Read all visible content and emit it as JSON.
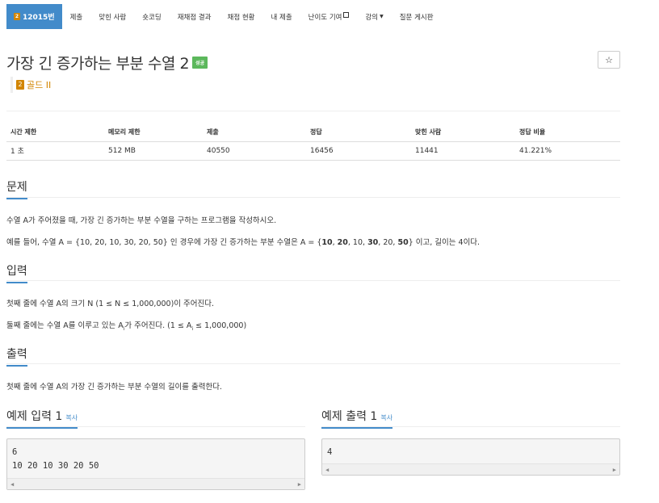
{
  "tabs": [
    {
      "label": "12015번",
      "tier": "2",
      "active": true
    },
    {
      "label": "제출"
    },
    {
      "label": "맞힌 사람"
    },
    {
      "label": "숏코딩"
    },
    {
      "label": "재채점 결과"
    },
    {
      "label": "채점 현황"
    },
    {
      "label": "내 제출"
    },
    {
      "label": "난이도 기여"
    },
    {
      "label": "강의"
    },
    {
      "label": "질문 게시판"
    }
  ],
  "problem": {
    "title": "가장 긴 증가하는 부분 수열 2",
    "badge": "성공",
    "star": "☆",
    "tier_icon": "2",
    "tier_label": "골드 II"
  },
  "info": {
    "headers": [
      "시간 제한",
      "메모리 제한",
      "제출",
      "정답",
      "맞힌 사람",
      "정답 비율"
    ],
    "values": [
      "1 초",
      "512 MB",
      "40550",
      "16456",
      "11441",
      "41.221%"
    ]
  },
  "sections": {
    "problem_head": "문제",
    "problem_p1": "수열 A가 주어졌을 때, 가장 긴 증가하는 부분 수열을 구하는 프로그램을 작성하시오.",
    "problem_p2_a": "예를 들어, 수열 A = {10, 20, 10, 30, 20, 50} 인 경우에 가장 긴 증가하는 부분 수열은 A = {",
    "problem_p2_b1": "10",
    "problem_p2_c1": ", ",
    "problem_p2_b2": "20",
    "problem_p2_c2": ", 10, ",
    "problem_p2_b3": "30",
    "problem_p2_c3": ", 20, ",
    "problem_p2_b4": "50",
    "problem_p2_d": "} 이고, 길이는 4이다.",
    "input_head": "입력",
    "input_p1": "첫째 줄에 수열 A의 크기 N (1 ≤ N ≤ 1,000,000)이 주어진다.",
    "input_p2_a": "둘째 줄에는 수열 A를 이루고 있는 A",
    "input_p2_sub1": "i",
    "input_p2_b": "가 주어진다. (1 ≤ A",
    "input_p2_sub2": "i",
    "input_p2_c": " ≤ 1,000,000)",
    "output_head": "출력",
    "output_p1": "첫째 줄에 수열 A의 가장 긴 증가하는 부분 수열의 길이를 출력한다."
  },
  "samples": {
    "input_title": "예제 입력 1",
    "output_title": "예제 출력 1",
    "copy_label": "복사",
    "input_text": "6\n10 20 10 30 20 50",
    "output_text": "4",
    "scroll_left": "◀",
    "scroll_right": "▶"
  },
  "colors": {
    "accent": "#428bca",
    "tier_gold": "#d28500",
    "success": "#5cb85c"
  },
  "icons": {
    "tier": "tier-badge-icon",
    "star": "star-icon",
    "external": "external-link-icon",
    "dropdown": "caret-down-icon"
  }
}
